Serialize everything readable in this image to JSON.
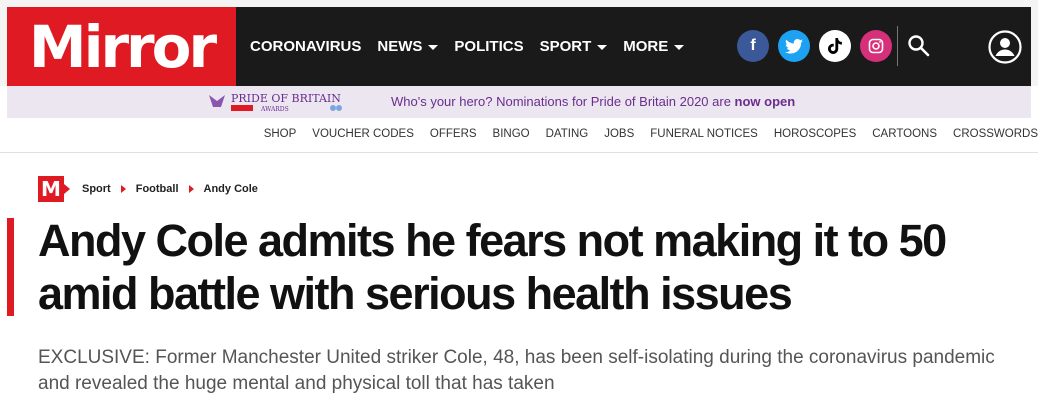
{
  "brand": {
    "logo_text": "Mirror",
    "accent": "#e01a22",
    "dark": "#1a1a1a"
  },
  "nav": {
    "items": [
      {
        "label": "CORONAVIRUS",
        "dropdown": false
      },
      {
        "label": "NEWS",
        "dropdown": true
      },
      {
        "label": "POLITICS",
        "dropdown": false
      },
      {
        "label": "SPORT",
        "dropdown": true
      },
      {
        "label": "MORE",
        "dropdown": true
      }
    ]
  },
  "social": {
    "facebook": "f",
    "twitter": "twitter-icon",
    "tiktok": "tiktok-icon",
    "instagram": "instagram-icon"
  },
  "pride": {
    "logo_text": "PRIDE OF BRITAIN",
    "logo_sub": "AWARDS",
    "text_before": "Who's your hero? Nominations for Pride of Britain 2020 are ",
    "text_bold": "now open",
    "color": "#6a2e8c"
  },
  "sublinks": [
    "SHOP",
    "VOUCHER CODES",
    "OFFERS",
    "BINGO",
    "DATING",
    "JOBS",
    "FUNERAL NOTICES",
    "HOROSCOPES",
    "CARTOONS",
    "CROSSWORDS"
  ],
  "breadcrumb": {
    "badge": "M",
    "items": [
      "Sport",
      "Football",
      "Andy Cole"
    ]
  },
  "article": {
    "headline": "Andy Cole admits he fears not making it to 50 amid battle with serious health issues",
    "standfirst": "EXCLUSIVE: Former Manchester United striker Cole, 48, has been self-isolating during the coronavirus pandemic and revealed the huge mental and physical toll that has taken"
  }
}
